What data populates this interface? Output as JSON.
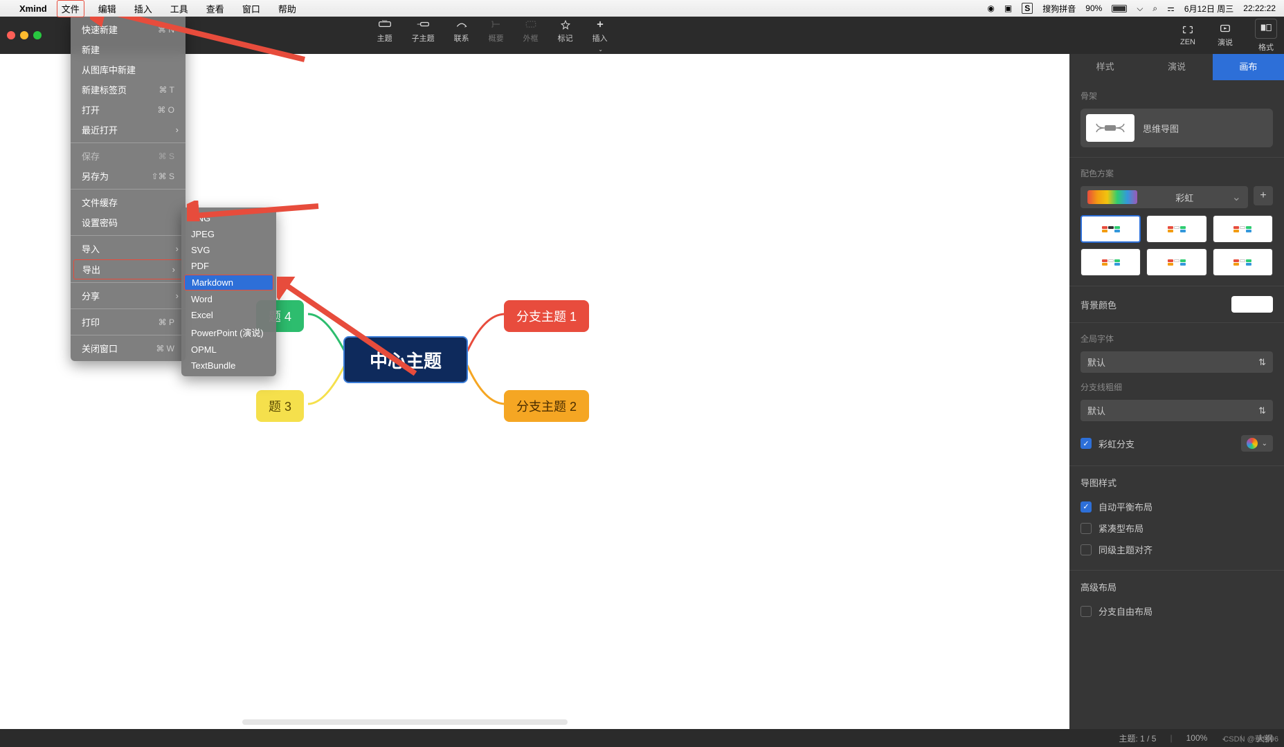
{
  "menubar": {
    "app": "Xmind",
    "items": [
      "文件",
      "编辑",
      "插入",
      "工具",
      "查看",
      "窗口",
      "帮助"
    ],
    "right": {
      "ime": "搜狗拼音",
      "battery": "90%",
      "date": "6月12日 周三",
      "time": "22:22:22"
    }
  },
  "toolbar": {
    "buttons": [
      "主题",
      "子主题",
      "联系",
      "概要",
      "外框",
      "标记",
      "插入"
    ],
    "right": [
      "ZEN",
      "演说",
      "格式"
    ]
  },
  "dropdown": {
    "items": [
      {
        "label": "快速新建",
        "sc": "⌘ N"
      },
      {
        "label": "新建"
      },
      {
        "label": "从图库中新建"
      },
      {
        "label": "新建标签页",
        "sc": "⌘ T"
      },
      {
        "label": "打开",
        "sc": "⌘ O"
      },
      {
        "label": "最近打开",
        "sub": true
      },
      {
        "sep": true
      },
      {
        "label": "保存",
        "sc": "⌘ S",
        "disabled": true
      },
      {
        "label": "另存为",
        "sc": "⇧⌘ S"
      },
      {
        "sep": true
      },
      {
        "label": "文件缓存"
      },
      {
        "label": "设置密码"
      },
      {
        "sep": true
      },
      {
        "label": "导入",
        "sub": true
      },
      {
        "label": "导出",
        "sub": true,
        "hl": true
      },
      {
        "sep": true
      },
      {
        "label": "分享",
        "sub": true
      },
      {
        "sep": true
      },
      {
        "label": "打印",
        "sc": "⌘ P"
      },
      {
        "sep": true
      },
      {
        "label": "关闭窗口",
        "sc": "⌘ W"
      }
    ]
  },
  "submenu": {
    "items": [
      "PNG",
      "JPEG",
      "SVG",
      "PDF",
      "Markdown",
      "Word",
      "Excel",
      "PowerPoint (演说)",
      "OPML",
      "TextBundle"
    ],
    "selected": "Markdown"
  },
  "mindmap": {
    "center": "中心主题",
    "branch1": "分支主题 1",
    "branch2": "分支主题 2",
    "branch3": "题 3",
    "branch4": "题 4"
  },
  "sidepanel": {
    "tabs": [
      "样式",
      "演说",
      "画布"
    ],
    "skeleton_label": "骨架",
    "structure": "思维导图",
    "palette_label": "配色方案",
    "palette_name": "彩虹",
    "bgcolor_label": "背景颜色",
    "globalfont_label": "全局字体",
    "globalfont_value": "默认",
    "branchwidth_label": "分支线粗细",
    "branchwidth_value": "默认",
    "rainbow_branch": "彩虹分支",
    "mapstyle_label": "导图样式",
    "auto_balance": "自动平衡布局",
    "compact": "紧凑型布局",
    "same_level": "同级主题对齐",
    "advanced_label": "高级布局",
    "free_branch": "分支自由布局"
  },
  "footer": {
    "topic": "主题: 1 / 5",
    "zoom": "100%",
    "outline": "大纲"
  },
  "watermark": "CSDN @華仔96"
}
